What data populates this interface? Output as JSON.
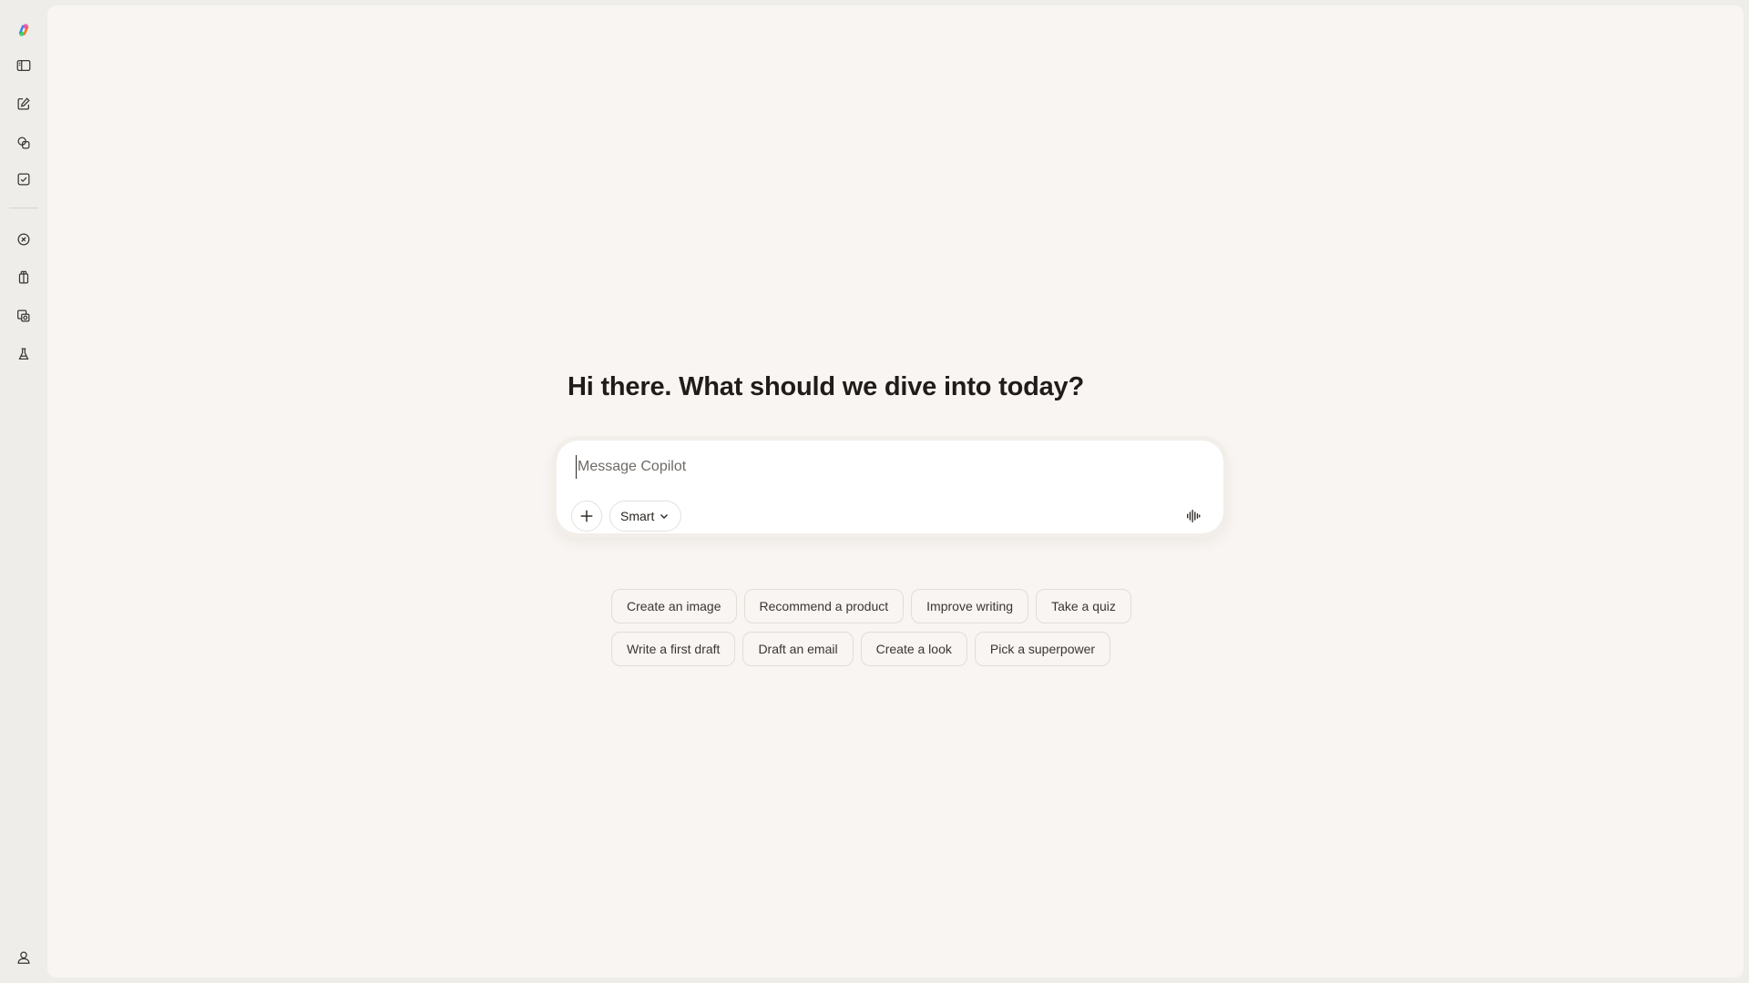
{
  "sidebar": {
    "top_items": [
      {
        "icon": "copilot-logo-icon"
      },
      {
        "icon": "sidebar-toggle-icon"
      },
      {
        "icon": "new-chat-icon"
      },
      {
        "icon": "library-icon"
      },
      {
        "icon": "tasks-icon"
      }
    ],
    "bottom_items": [
      {
        "icon": "discover-icon"
      },
      {
        "icon": "gift-icon"
      },
      {
        "icon": "pages-icon"
      },
      {
        "icon": "labs-icon"
      }
    ],
    "profile_icon": "profile-icon"
  },
  "main": {
    "greeting": "Hi there. What should we dive into today?"
  },
  "composer": {
    "placeholder": "Message Copilot",
    "mode_label": "Smart"
  },
  "suggestions": {
    "row1": [
      "Create an image",
      "Recommend a product",
      "Improve writing",
      "Take a quiz"
    ],
    "row2": [
      "Write a first draft",
      "Draft an email",
      "Create a look",
      "Pick a superpower"
    ]
  },
  "colors": {
    "page_background": "#efedea",
    "canvas_background": "#f8f5f2",
    "composer_background": "#ffffff",
    "text": "#1d1b19"
  }
}
